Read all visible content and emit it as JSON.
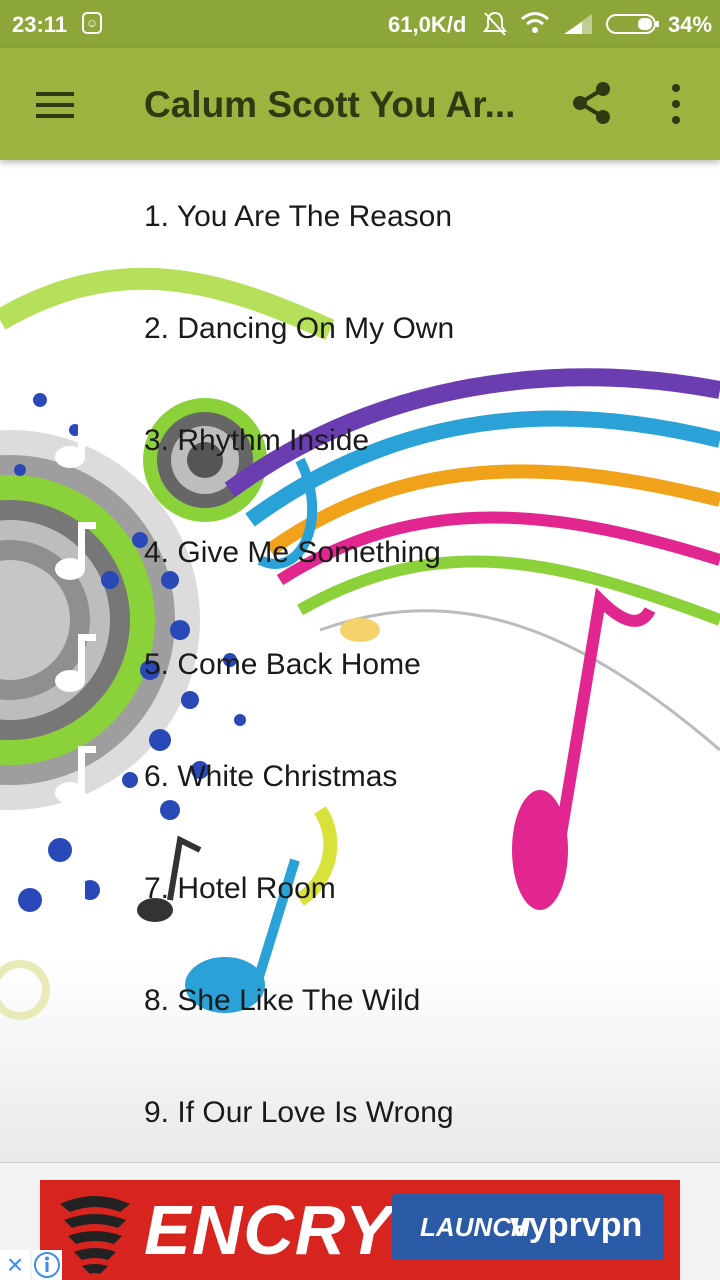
{
  "status_bar": {
    "time": "23:11",
    "speed": "61,0K/d",
    "battery": "34%"
  },
  "app_bar": {
    "title": "Calum Scott You Ar..."
  },
  "songs": [
    "1. You Are The Reason",
    "2. Dancing On My Own",
    "3. Rhythm Inside",
    "4. Give Me Something",
    "5. Come Back Home",
    "6. White Christmas",
    "7. Hotel Room",
    "8. She Like The Wild",
    "9. If Our Love Is Wrong"
  ],
  "ad": {
    "headline": "ENCRYPT",
    "button_launch": "LAUNCH",
    "button_brand": "vyprvpn",
    "close_symbol": "×"
  },
  "colors": {
    "status_bar": "#8da63a",
    "app_bar": "#9bb33f",
    "title_text": "#2f3a12",
    "ad_red": "#d8241e",
    "ad_button": "#2b5aa6"
  }
}
